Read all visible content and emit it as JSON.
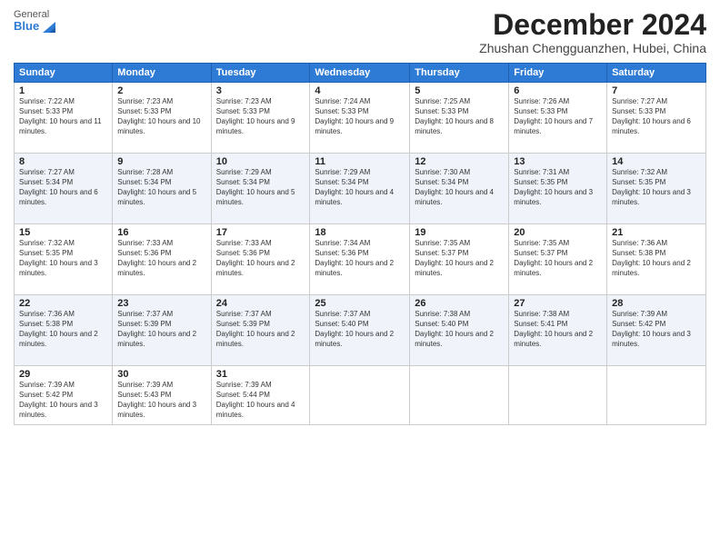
{
  "header": {
    "logo": {
      "general": "General",
      "blue": "Blue"
    },
    "title": "December 2024",
    "subtitle": "Zhushan Chengguanzhen, Hubei, China"
  },
  "weekdays": [
    "Sunday",
    "Monday",
    "Tuesday",
    "Wednesday",
    "Thursday",
    "Friday",
    "Saturday"
  ],
  "weeks": [
    [
      {
        "day": "1",
        "sunrise": "7:22 AM",
        "sunset": "5:33 PM",
        "daylight": "10 hours and 11 minutes."
      },
      {
        "day": "2",
        "sunrise": "7:23 AM",
        "sunset": "5:33 PM",
        "daylight": "10 hours and 10 minutes."
      },
      {
        "day": "3",
        "sunrise": "7:23 AM",
        "sunset": "5:33 PM",
        "daylight": "10 hours and 9 minutes."
      },
      {
        "day": "4",
        "sunrise": "7:24 AM",
        "sunset": "5:33 PM",
        "daylight": "10 hours and 9 minutes."
      },
      {
        "day": "5",
        "sunrise": "7:25 AM",
        "sunset": "5:33 PM",
        "daylight": "10 hours and 8 minutes."
      },
      {
        "day": "6",
        "sunrise": "7:26 AM",
        "sunset": "5:33 PM",
        "daylight": "10 hours and 7 minutes."
      },
      {
        "day": "7",
        "sunrise": "7:27 AM",
        "sunset": "5:33 PM",
        "daylight": "10 hours and 6 minutes."
      }
    ],
    [
      {
        "day": "8",
        "sunrise": "7:27 AM",
        "sunset": "5:34 PM",
        "daylight": "10 hours and 6 minutes."
      },
      {
        "day": "9",
        "sunrise": "7:28 AM",
        "sunset": "5:34 PM",
        "daylight": "10 hours and 5 minutes."
      },
      {
        "day": "10",
        "sunrise": "7:29 AM",
        "sunset": "5:34 PM",
        "daylight": "10 hours and 5 minutes."
      },
      {
        "day": "11",
        "sunrise": "7:29 AM",
        "sunset": "5:34 PM",
        "daylight": "10 hours and 4 minutes."
      },
      {
        "day": "12",
        "sunrise": "7:30 AM",
        "sunset": "5:34 PM",
        "daylight": "10 hours and 4 minutes."
      },
      {
        "day": "13",
        "sunrise": "7:31 AM",
        "sunset": "5:35 PM",
        "daylight": "10 hours and 3 minutes."
      },
      {
        "day": "14",
        "sunrise": "7:32 AM",
        "sunset": "5:35 PM",
        "daylight": "10 hours and 3 minutes."
      }
    ],
    [
      {
        "day": "15",
        "sunrise": "7:32 AM",
        "sunset": "5:35 PM",
        "daylight": "10 hours and 3 minutes."
      },
      {
        "day": "16",
        "sunrise": "7:33 AM",
        "sunset": "5:36 PM",
        "daylight": "10 hours and 2 minutes."
      },
      {
        "day": "17",
        "sunrise": "7:33 AM",
        "sunset": "5:36 PM",
        "daylight": "10 hours and 2 minutes."
      },
      {
        "day": "18",
        "sunrise": "7:34 AM",
        "sunset": "5:36 PM",
        "daylight": "10 hours and 2 minutes."
      },
      {
        "day": "19",
        "sunrise": "7:35 AM",
        "sunset": "5:37 PM",
        "daylight": "10 hours and 2 minutes."
      },
      {
        "day": "20",
        "sunrise": "7:35 AM",
        "sunset": "5:37 PM",
        "daylight": "10 hours and 2 minutes."
      },
      {
        "day": "21",
        "sunrise": "7:36 AM",
        "sunset": "5:38 PM",
        "daylight": "10 hours and 2 minutes."
      }
    ],
    [
      {
        "day": "22",
        "sunrise": "7:36 AM",
        "sunset": "5:38 PM",
        "daylight": "10 hours and 2 minutes."
      },
      {
        "day": "23",
        "sunrise": "7:37 AM",
        "sunset": "5:39 PM",
        "daylight": "10 hours and 2 minutes."
      },
      {
        "day": "24",
        "sunrise": "7:37 AM",
        "sunset": "5:39 PM",
        "daylight": "10 hours and 2 minutes."
      },
      {
        "day": "25",
        "sunrise": "7:37 AM",
        "sunset": "5:40 PM",
        "daylight": "10 hours and 2 minutes."
      },
      {
        "day": "26",
        "sunrise": "7:38 AM",
        "sunset": "5:40 PM",
        "daylight": "10 hours and 2 minutes."
      },
      {
        "day": "27",
        "sunrise": "7:38 AM",
        "sunset": "5:41 PM",
        "daylight": "10 hours and 2 minutes."
      },
      {
        "day": "28",
        "sunrise": "7:39 AM",
        "sunset": "5:42 PM",
        "daylight": "10 hours and 3 minutes."
      }
    ],
    [
      {
        "day": "29",
        "sunrise": "7:39 AM",
        "sunset": "5:42 PM",
        "daylight": "10 hours and 3 minutes."
      },
      {
        "day": "30",
        "sunrise": "7:39 AM",
        "sunset": "5:43 PM",
        "daylight": "10 hours and 3 minutes."
      },
      {
        "day": "31",
        "sunrise": "7:39 AM",
        "sunset": "5:44 PM",
        "daylight": "10 hours and 4 minutes."
      },
      null,
      null,
      null,
      null
    ]
  ]
}
